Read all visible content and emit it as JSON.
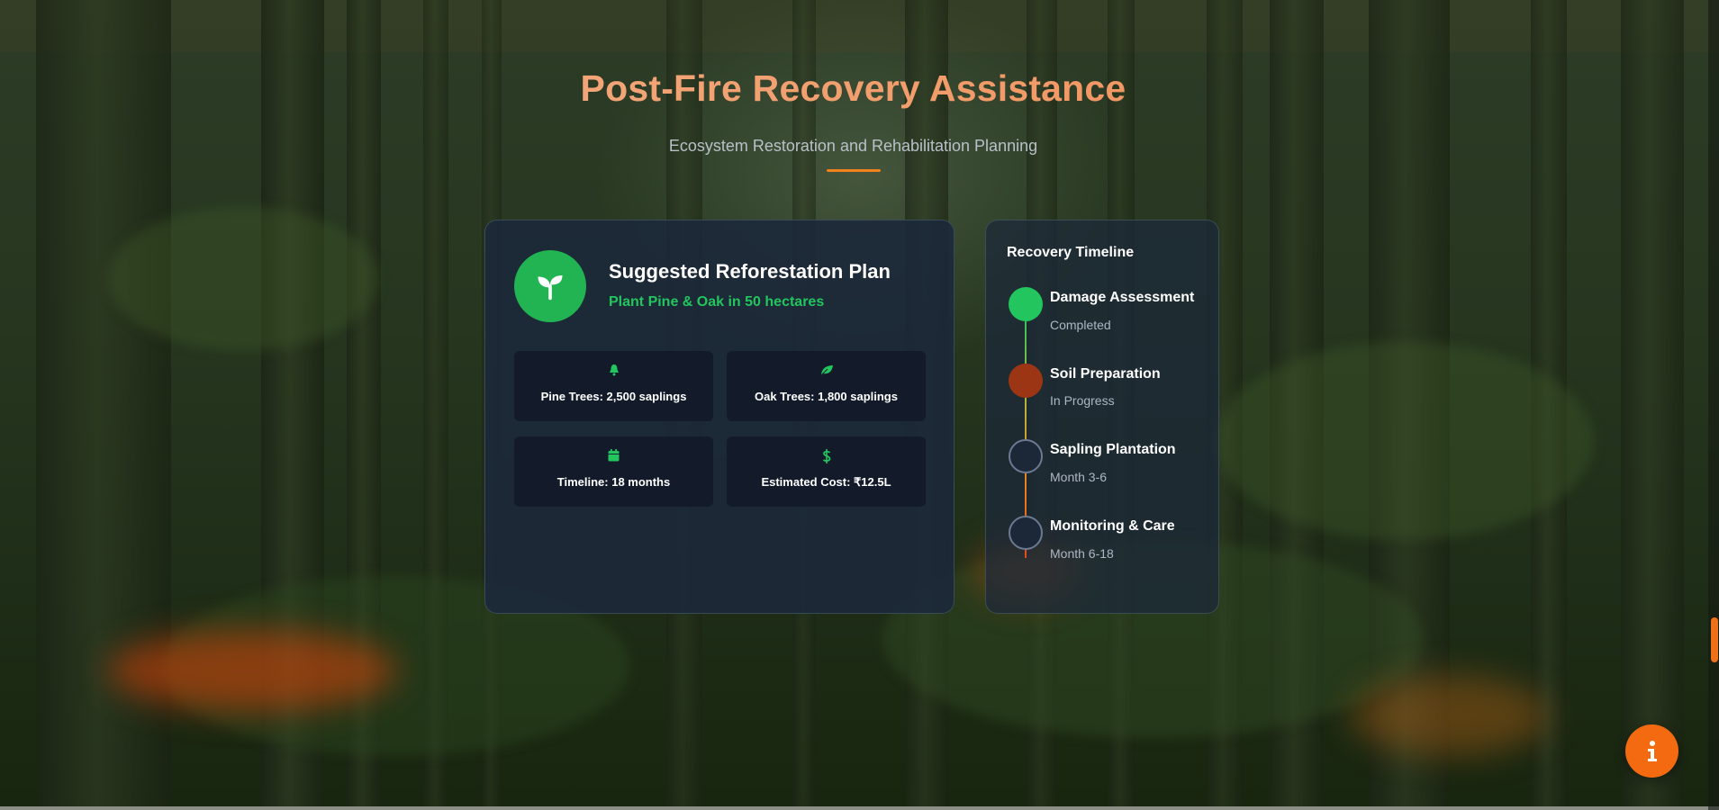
{
  "header": {
    "title": "Post-Fire Recovery Assistance",
    "subtitle": "Ecosystem Restoration and Rehabilitation Planning"
  },
  "plan": {
    "title": "Suggested Reforestation Plan",
    "subtitle": "Plant Pine & Oak in 50 hectares",
    "icon": "seedling-icon",
    "stats": [
      {
        "icon": "tree-icon",
        "text": "Pine Trees: 2,500 saplings"
      },
      {
        "icon": "leaf-icon",
        "text": "Oak Trees: 1,800 saplings"
      },
      {
        "icon": "calendar-icon",
        "text": "Timeline: 18 months"
      },
      {
        "icon": "dollar-icon",
        "text": "Estimated Cost: ₹12.5L"
      }
    ]
  },
  "timeline": {
    "title": "Recovery Timeline",
    "steps": [
      {
        "name": "Damage Assessment",
        "status": "Completed",
        "state": "done"
      },
      {
        "name": "Soil Preparation",
        "status": "In Progress",
        "state": "in-progress"
      },
      {
        "name": "Sapling Plantation",
        "status": "Month 3-6",
        "state": "pending"
      },
      {
        "name": "Monitoring & Care",
        "status": "Month 6-18",
        "state": "pending"
      }
    ]
  },
  "info_button": {
    "icon": "info-icon"
  },
  "colors": {
    "accent_orange": "#f2821e",
    "accent_green": "#22c55e",
    "progress_red": "#9c3514"
  }
}
